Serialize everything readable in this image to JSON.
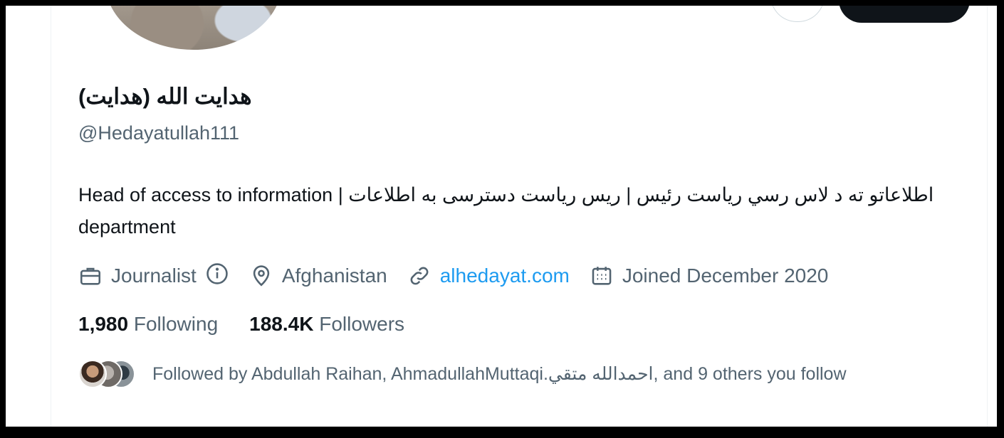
{
  "profile": {
    "display_name": "هدايت الله (هدايت)",
    "handle": "@Hedayatullah111",
    "bio": "اطلاعاتو ته د لاس رسي رياست رئيس | ریس ریاست دسترسی به اطلاعات | Head of access to information department"
  },
  "meta": {
    "profession": "Journalist",
    "location": "Afghanistan",
    "website": "alhedayat.com",
    "joined": "Joined December 2020"
  },
  "counts": {
    "following_value": "1,980",
    "following_label": "Following",
    "followers_value": "188.4K",
    "followers_label": "Followers"
  },
  "followed_by": {
    "text": "Followed by Abdullah Raihan, AhmadullahMuttaqi.احمدالله متقي, and 9 others you follow"
  },
  "icons": {
    "profession": "briefcase-icon",
    "info": "info-icon",
    "location": "location-pin-icon",
    "website": "link-icon",
    "joined": "calendar-icon"
  },
  "colors": {
    "link": "#1d9bf0",
    "secondary_text": "#536471",
    "primary_text": "#0f1419"
  }
}
